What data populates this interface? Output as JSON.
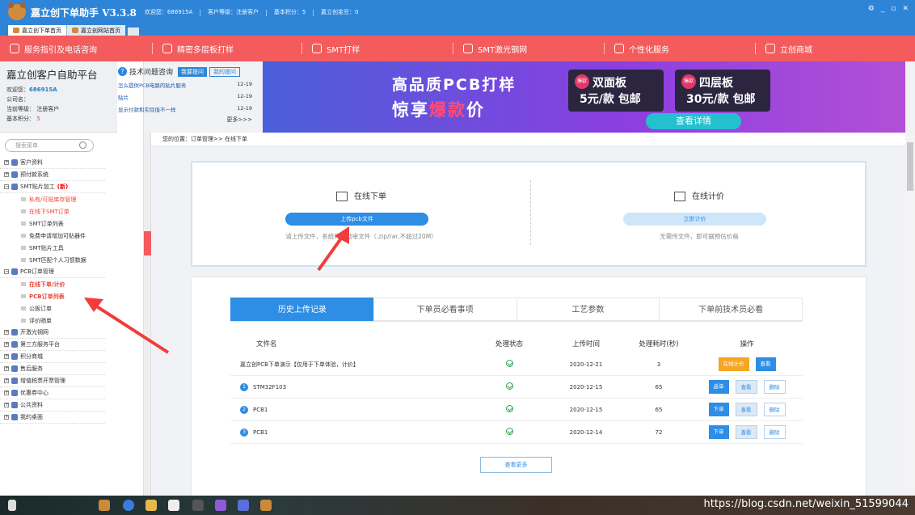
{
  "titlebar": {
    "app_title": "嘉立创下单助手 V3.3.8",
    "welcome": "欢迎您：686915A",
    "level": "客户等级：注册客户",
    "points": "基本积分：5",
    "coins": "嘉立创金豆：0"
  },
  "tabs": [
    {
      "label": "嘉立创下单首页"
    },
    {
      "label": "嘉立创网站首页"
    }
  ],
  "nav": [
    {
      "label": "服务指引及电话咨询"
    },
    {
      "label": "精密多层板打样"
    },
    {
      "label": "SMT打样"
    },
    {
      "label": "SMT激光钢网"
    },
    {
      "label": "个性化服务"
    },
    {
      "label": "立创商城"
    }
  ],
  "user": {
    "platform": "嘉立创客户自助平台",
    "welcome_label": "欢迎您：",
    "welcome_value": "686915A",
    "company_label": "公司名：",
    "level_label": "当前等级：",
    "level_value": "注册客户",
    "points_label": "基本积分：",
    "points_value": "5"
  },
  "tech": {
    "title": "技术问题咨询",
    "btn_ask": "我要提问",
    "btn_mine": "我的提问",
    "questions": [
      {
        "text": "怎么提供PCB电路的贴片服务",
        "date": "12-19"
      },
      {
        "text": "贴片",
        "date": "12-19"
      },
      {
        "text": "显示付款和实际值不一样",
        "date": "12-19"
      }
    ],
    "more": "更多>>>"
  },
  "banner": {
    "line1": "高品质PCB打样",
    "line2_pre": "惊享",
    "line2_hl": "爆款",
    "line2_post": "价",
    "card1_badge": "爆款",
    "card1_title": "双面板",
    "card1_price": "5元/款 包邮",
    "card2_badge": "爆款",
    "card2_title": "四层板",
    "card2_price": "30元/款 包邮",
    "cta": "查看详情"
  },
  "search": {
    "placeholder": "搜索菜单"
  },
  "menu": {
    "groups": [
      {
        "label": "客户资料"
      },
      {
        "label": "预付款系统"
      },
      {
        "label": "SMT贴片加工",
        "badge": "(新)"
      },
      {
        "label": "PCB订单管理"
      },
      {
        "label": "开激光钢网"
      },
      {
        "label": "第三方服务平台"
      },
      {
        "label": "积分商城"
      },
      {
        "label": "售后服务"
      },
      {
        "label": "增值税票开票管理"
      },
      {
        "label": "优惠券中心"
      },
      {
        "label": "公共资料"
      },
      {
        "label": "我的桌面"
      }
    ],
    "smt_items": [
      "私有/可贴库存管理",
      "在线下SMT订单",
      "SMT订单列表",
      "免费申请增加可贴器件",
      "SMT贴片工具",
      "SMT匹配个人习惯数据"
    ],
    "pcb_items": [
      "在线下单/计价",
      "PCB订单列表",
      "公板订单",
      "评价晒单"
    ]
  },
  "breadcrumb": "您的位置：订单管理>> 在线下单",
  "upload": {
    "left_title": "在线下单",
    "left_btn": "上传pcb文件",
    "left_hint": "请上传文件，系统将自动审文件（.zip/rar,不超过20M）",
    "right_title": "在线计价",
    "right_btn": "立即计价",
    "right_hint": "无需传文件，即可据预估价格"
  },
  "history": {
    "tabs": [
      "历史上传记录",
      "下单员必看事项",
      "工艺参数",
      "下单前技术员必看"
    ],
    "headers": [
      "文件名",
      "处理状态",
      "上传时间",
      "处理耗时(秒)",
      "操作"
    ],
    "rows": [
      {
        "num": "",
        "name": "嘉立创PCB下单演示【仅用于下单体验，计价】",
        "date": "2020-12-21",
        "secs": "3",
        "actions": [
          "在线计价",
          "查看"
        ]
      },
      {
        "num": "1",
        "name": "STM32F103",
        "date": "2020-12-15",
        "secs": "65",
        "actions": [
          "返单",
          "查看",
          "删除"
        ]
      },
      {
        "num": "2",
        "name": "PCB1",
        "date": "2020-12-15",
        "secs": "65",
        "actions": [
          "下单",
          "查看",
          "删除"
        ]
      },
      {
        "num": "3",
        "name": "PCB1",
        "date": "2020-12-14",
        "secs": "72",
        "actions": [
          "下单",
          "查看",
          "删除"
        ]
      }
    ],
    "view_more": "查看更多"
  },
  "watermark": "https://blog.csdn.net/weixin_51599044",
  "colors": {
    "nav_red": "#f35b5c",
    "primary_blue": "#2e85d8",
    "accent_orange": "#f5a623"
  }
}
